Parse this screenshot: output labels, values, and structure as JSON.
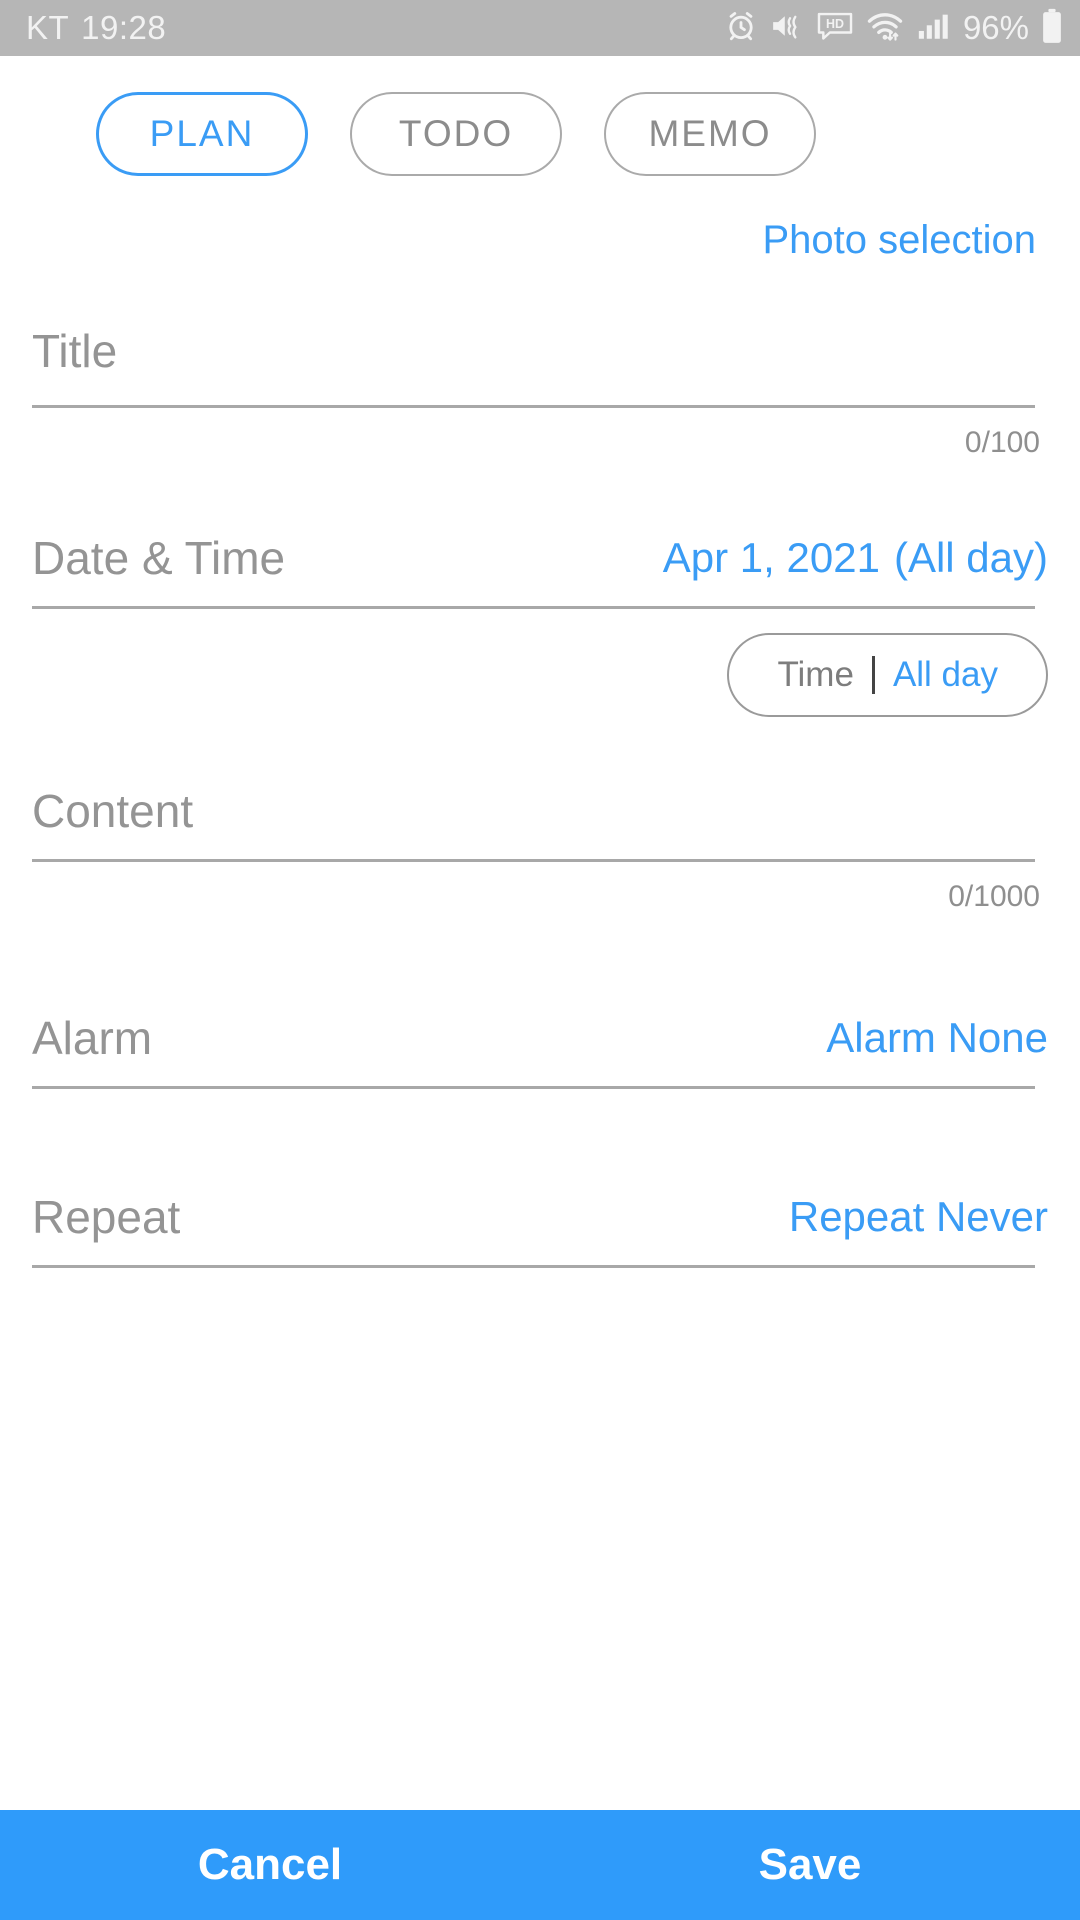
{
  "status_bar": {
    "carrier": "KT",
    "time": "19:28",
    "battery_percent": "96%",
    "icons": [
      "alarm-clock-icon",
      "mute-vibrate-icon",
      "hd-voice-icon",
      "wifi-icon",
      "cellular-signal-icon",
      "battery-icon"
    ],
    "background_color": "#b6b6b6",
    "text_color": "#f2f2f2"
  },
  "tabs": [
    {
      "label": "PLAN",
      "active": true
    },
    {
      "label": "TODO",
      "active": false
    },
    {
      "label": "MEMO",
      "active": false
    }
  ],
  "actions": {
    "photo_selection": "Photo selection"
  },
  "form": {
    "title": {
      "label": "Title",
      "placeholder": "Title",
      "value": "",
      "counter": "0/100"
    },
    "datetime": {
      "label": "Date & Time",
      "date_value": "Apr 1, 2021",
      "allday_value": "(All day)"
    },
    "time_toggle": {
      "time_label": "Time",
      "separator": "|",
      "allday_label": "All day",
      "selected": "All day"
    },
    "content": {
      "label": "Content",
      "placeholder": "Content",
      "value": "",
      "counter": "0/1000"
    },
    "alarm": {
      "label": "Alarm",
      "value": "Alarm None"
    },
    "repeat": {
      "label": "Repeat",
      "value": "Repeat Never"
    }
  },
  "bottom_bar": {
    "cancel_label": "Cancel",
    "save_label": "Save",
    "background_color": "#2f9bfa"
  },
  "theme": {
    "accent_blue": "#3a9cf5",
    "bar_blue": "#2f9bfa",
    "label_gray": "#949494",
    "divider_gray": "#a8a8a8",
    "status_gray": "#b6b6b6"
  }
}
